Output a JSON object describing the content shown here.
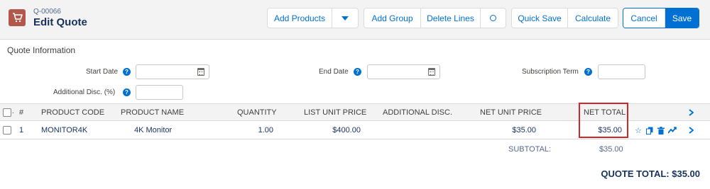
{
  "header": {
    "record_number": "Q-00066",
    "title": "Edit Quote",
    "icon": "cart-icon",
    "brand_color": "#b2574b"
  },
  "toolbar": {
    "add_products": "Add Products",
    "add_group": "Add Group",
    "delete_lines": "Delete Lines",
    "circle_btn": "O",
    "quick_save": "Quick Save",
    "calculate": "Calculate",
    "cancel": "Cancel",
    "save": "Save",
    "accent_color": "#0070d2"
  },
  "section": {
    "title": "Quote Information"
  },
  "fields": {
    "start_date": {
      "label": "Start Date",
      "value": ""
    },
    "end_date": {
      "label": "End Date",
      "value": ""
    },
    "subscription_term": {
      "label": "Subscription Term",
      "value": ""
    },
    "additional_disc": {
      "label": "Additional Disc. (%)",
      "value": ""
    }
  },
  "table": {
    "columns": [
      "#",
      "PRODUCT CODE",
      "PRODUCT NAME",
      "QUANTITY",
      "LIST UNIT PRICE",
      "ADDITIONAL DISC.",
      "NET UNIT PRICE",
      "NET TOTAL"
    ],
    "rows": [
      {
        "num": "1",
        "product_code": "MONITOR4K",
        "product_name": "4K Monitor",
        "quantity": "1.00",
        "list_unit_price": "$400.00",
        "additional_disc": "",
        "net_unit_price": "$35.00",
        "net_total": "$35.00"
      }
    ]
  },
  "totals": {
    "subtotal_label": "SUBTOTAL:",
    "subtotal_value": "$35.00",
    "quote_total": "QUOTE TOTAL: $35.00"
  }
}
